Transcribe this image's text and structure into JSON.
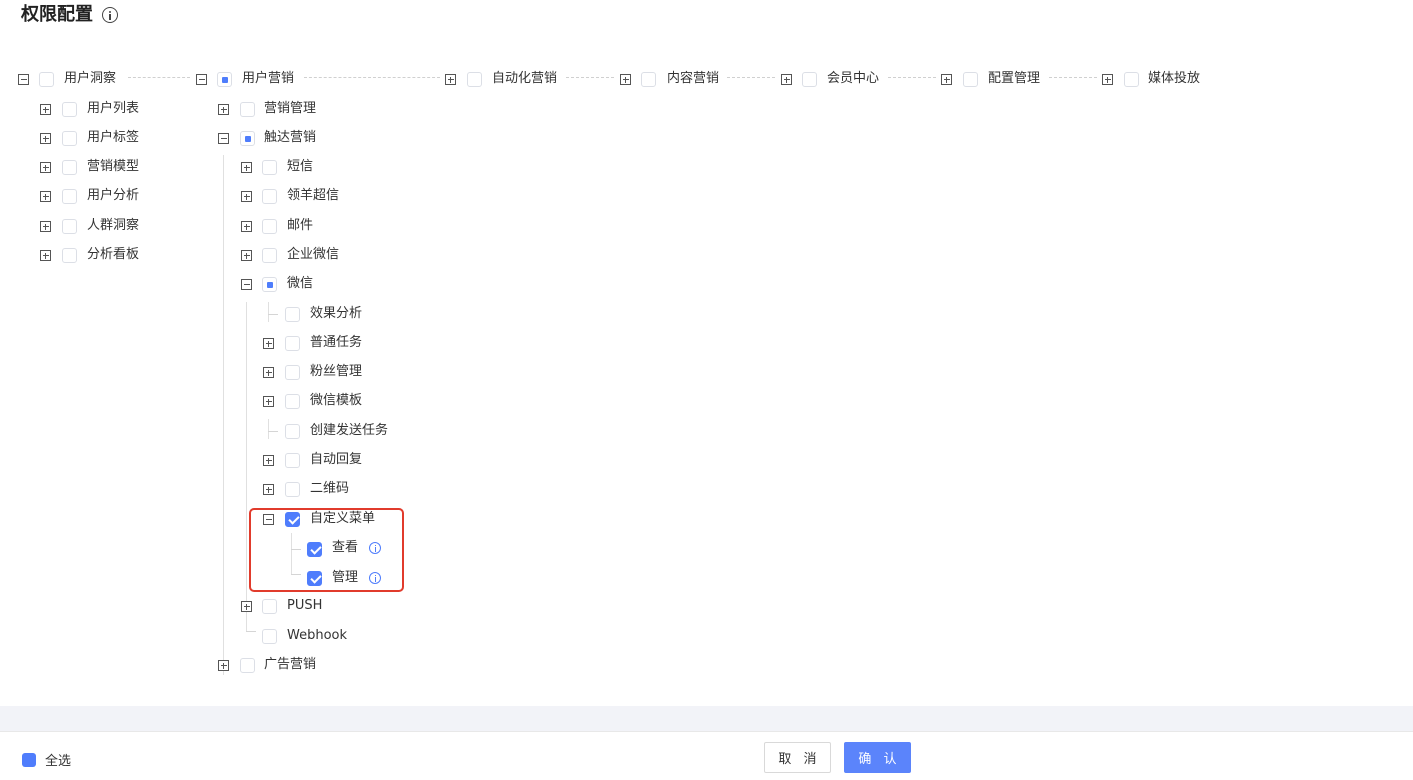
{
  "page": {
    "title": "权限配置"
  },
  "tree": {
    "top": [
      {
        "id": "t1",
        "label": "用户洞察",
        "state": "unchecked",
        "expanded": true
      },
      {
        "id": "t2",
        "label": "用户营销",
        "state": "half",
        "expanded": true
      },
      {
        "id": "t3",
        "label": "自动化营销",
        "state": "unchecked",
        "expanded": false
      },
      {
        "id": "t4",
        "label": "内容营销",
        "state": "unchecked",
        "expanded": false
      },
      {
        "id": "t5",
        "label": "会员中心",
        "state": "unchecked",
        "expanded": false
      },
      {
        "id": "t6",
        "label": "配置管理",
        "state": "unchecked",
        "expanded": false
      },
      {
        "id": "t7",
        "label": "媒体投放",
        "state": "unchecked",
        "expanded": false
      }
    ],
    "insight_children": [
      {
        "label": "用户列表",
        "state": "unchecked"
      },
      {
        "label": "用户标签",
        "state": "unchecked"
      },
      {
        "label": "营销模型",
        "state": "unchecked"
      },
      {
        "label": "用户分析",
        "state": "unchecked"
      },
      {
        "label": "人群洞察",
        "state": "unchecked"
      },
      {
        "label": "分析看板",
        "state": "unchecked"
      }
    ],
    "marketing_children": [
      {
        "label": "营销管理",
        "state": "unchecked"
      },
      {
        "label": "触达营销",
        "state": "half"
      },
      {
        "label": "广告营销",
        "state": "unchecked"
      }
    ],
    "reach_children": [
      {
        "label": "短信",
        "state": "unchecked"
      },
      {
        "label": "领羊超信",
        "state": "unchecked"
      },
      {
        "label": "邮件",
        "state": "unchecked"
      },
      {
        "label": "企业微信",
        "state": "unchecked"
      },
      {
        "label": "微信",
        "state": "half"
      },
      {
        "label": "PUSH",
        "state": "unchecked"
      },
      {
        "label": "Webhook",
        "state": "unchecked"
      }
    ],
    "wechat_children": [
      {
        "label": "效果分析",
        "state": "unchecked"
      },
      {
        "label": "普通任务",
        "state": "unchecked"
      },
      {
        "label": "粉丝管理",
        "state": "unchecked"
      },
      {
        "label": "微信模板",
        "state": "unchecked"
      },
      {
        "label": "创建发送任务",
        "state": "unchecked"
      },
      {
        "label": "自动回复",
        "state": "unchecked"
      },
      {
        "label": "二维码",
        "state": "unchecked"
      },
      {
        "label": "自定义菜单",
        "state": "checked"
      }
    ],
    "menu_children": [
      {
        "label": "查看",
        "state": "checked"
      },
      {
        "label": "管理",
        "state": "checked"
      }
    ]
  },
  "footer": {
    "select_all_label": "全选",
    "cancel_label": "取 消",
    "confirm_label": "确 认"
  },
  "colors": {
    "accent": "#4f7dfc",
    "highlight_border": "#e13b2c"
  }
}
